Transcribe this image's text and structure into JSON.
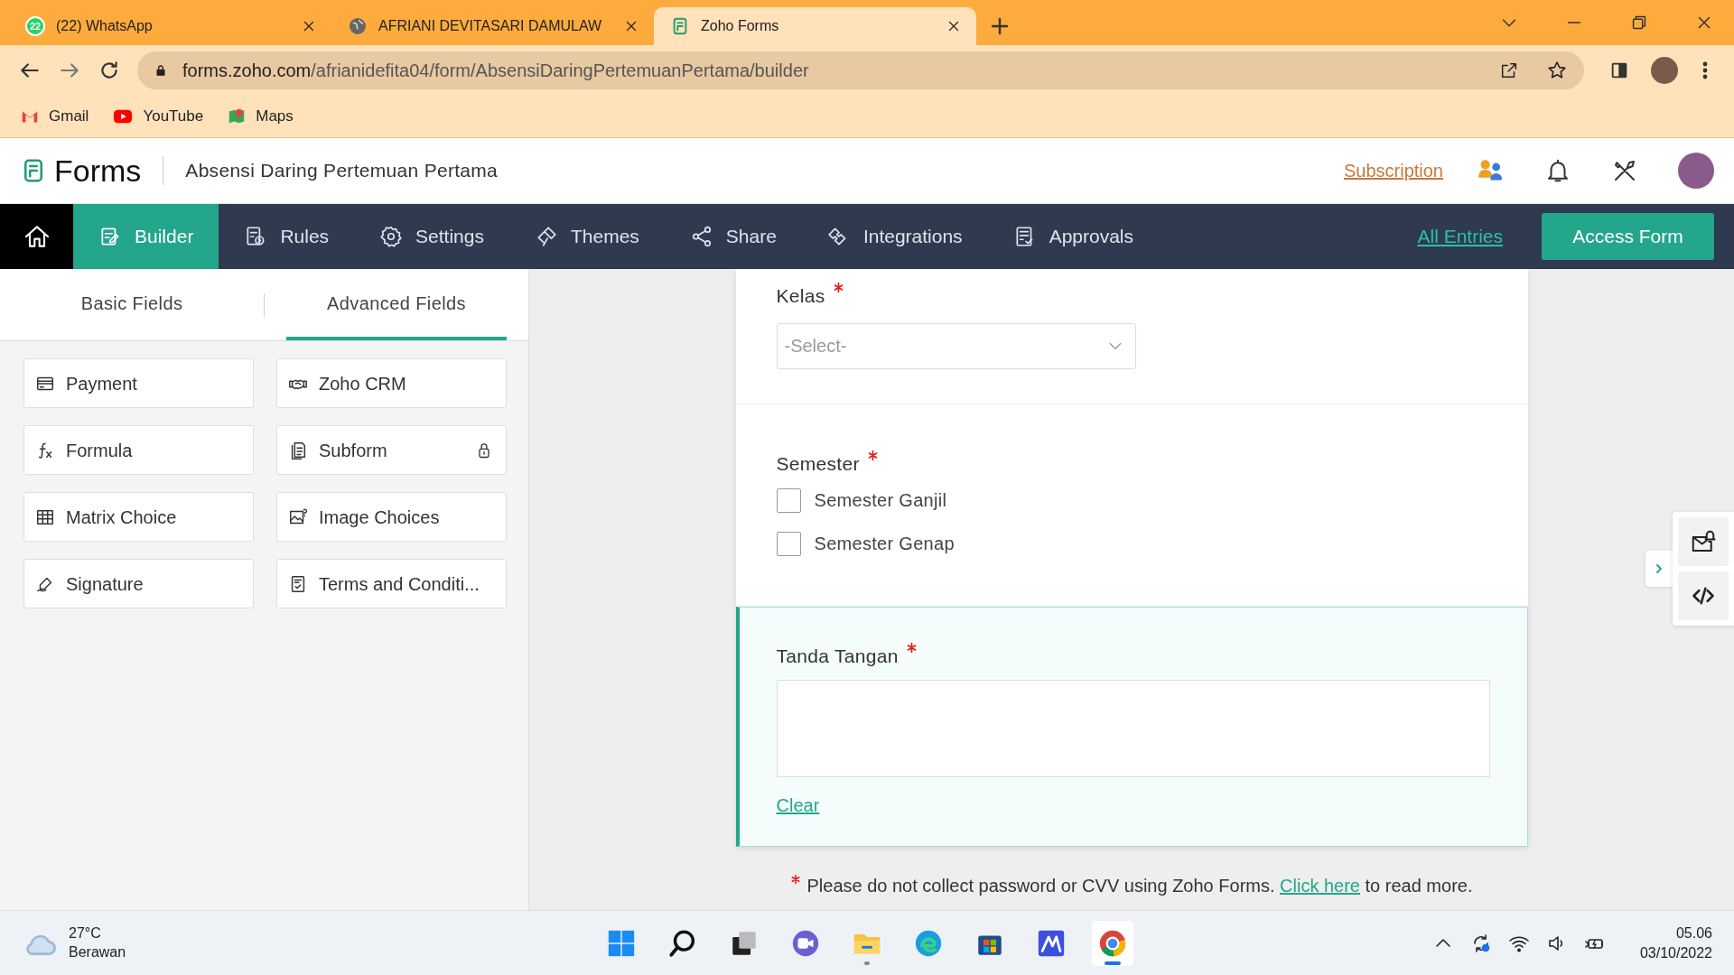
{
  "browser": {
    "tabs": [
      {
        "kind": "whatsapp",
        "badge": "22",
        "title": "(22) WhatsApp",
        "selected": false
      },
      {
        "kind": "globe",
        "title": "AFRIANI DEVITASARI DAMULAW",
        "selected": false
      },
      {
        "kind": "forms",
        "title": "Zoho Forms",
        "selected": true
      }
    ],
    "address": {
      "host": "forms.zoho.com",
      "path": "/afrianidefita04/form/AbsensiDaringPertemuanPertama/builder"
    },
    "bookmarks": [
      {
        "kind": "gmail",
        "label": "Gmail"
      },
      {
        "kind": "youtube",
        "label": "YouTube"
      },
      {
        "kind": "maps",
        "label": "Maps"
      }
    ]
  },
  "app": {
    "logo": "Forms",
    "form_title": "Absensi Daring Pertemuan Pertama",
    "subscription": "Subscription",
    "nav": [
      {
        "kind": "builder",
        "label": "Builder",
        "selected": true
      },
      {
        "kind": "rules",
        "label": "Rules",
        "selected": false
      },
      {
        "kind": "settings",
        "label": "Settings",
        "selected": false
      },
      {
        "kind": "themes",
        "label": "Themes",
        "selected": false
      },
      {
        "kind": "share",
        "label": "Share",
        "selected": false
      },
      {
        "kind": "integrations",
        "label": "Integrations",
        "selected": false
      },
      {
        "kind": "approvals",
        "label": "Approvals",
        "selected": false
      }
    ],
    "all_entries": "All Entries",
    "access_form": "Access Form"
  },
  "field_panel": {
    "tabs": [
      {
        "label": "Basic Fields",
        "selected": false
      },
      {
        "label": "Advanced Fields",
        "selected": true
      }
    ],
    "fields": [
      {
        "kind": "payment",
        "label": "Payment",
        "locked": false
      },
      {
        "kind": "crm",
        "label": "Zoho CRM",
        "locked": false
      },
      {
        "kind": "formula",
        "label": "Formula",
        "locked": false
      },
      {
        "kind": "subform",
        "label": "Subform",
        "locked": true
      },
      {
        "kind": "matrix",
        "label": "Matrix Choice",
        "locked": false
      },
      {
        "kind": "image",
        "label": "Image Choices",
        "locked": false
      },
      {
        "kind": "signature",
        "label": "Signature",
        "locked": false
      },
      {
        "kind": "terms",
        "label": "Terms and Conditi...",
        "locked": false
      }
    ]
  },
  "form": {
    "fields": [
      {
        "kind": "select",
        "label": "Kelas",
        "required": true,
        "placeholder": "-Select-",
        "selected": false
      },
      {
        "kind": "checkbox",
        "label": "Semester",
        "required": true,
        "selected": false,
        "options": [
          {
            "label": "Semester Ganjil",
            "checked": false
          },
          {
            "label": "Semester Genap",
            "checked": false
          }
        ]
      },
      {
        "kind": "signature",
        "label": "Tanda Tangan",
        "required": true,
        "clear": "Clear",
        "selected": true
      }
    ],
    "note": {
      "text": "Please do not collect password or CVV using Zoho Forms.",
      "link": "Click here",
      "after": "to read more."
    }
  },
  "taskbar": {
    "weather": {
      "temp": "27°C",
      "desc": "Berawan"
    },
    "apps": [
      {
        "kind": "start",
        "running": false,
        "selected": false
      },
      {
        "kind": "search",
        "running": false,
        "selected": false
      },
      {
        "kind": "taskview",
        "running": false,
        "selected": false
      },
      {
        "kind": "chat",
        "running": false,
        "selected": false
      },
      {
        "kind": "explorer",
        "running": true,
        "selected": false
      },
      {
        "kind": "edge",
        "running": false,
        "selected": false
      },
      {
        "kind": "store",
        "running": false,
        "selected": false
      },
      {
        "kind": "mpad",
        "running": false,
        "selected": false
      },
      {
        "kind": "chrome",
        "running": true,
        "selected": true
      }
    ],
    "time": "05.06",
    "date": "03/10/2022"
  }
}
